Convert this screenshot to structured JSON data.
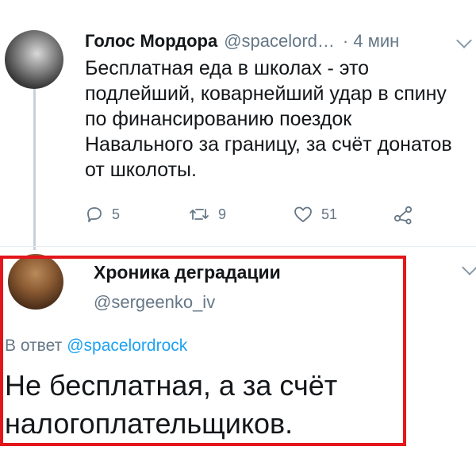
{
  "tweet1": {
    "author_name": "Голос Мордора",
    "author_handle": "@spacelord…",
    "time": "· 4 мин",
    "text": "Бесплатная еда в школах - это подлейший, коварнейший удар в спину по финансированию поездок Навального за границу, за счёт донатов от школоты.",
    "reply_count": "5",
    "retweet_count": "9",
    "like_count": "51"
  },
  "tweet2": {
    "author_name": "Хроника деградации",
    "author_handle": "@sergeenko_iv",
    "reply_prefix": "В ответ",
    "reply_mention": "@spacelordrock",
    "text": "Не бесплатная, а за счёт налогоплательщиков."
  },
  "colors": {
    "highlight_border": "#e3161b",
    "link": "#1da1f2",
    "secondary_text": "#657786"
  }
}
